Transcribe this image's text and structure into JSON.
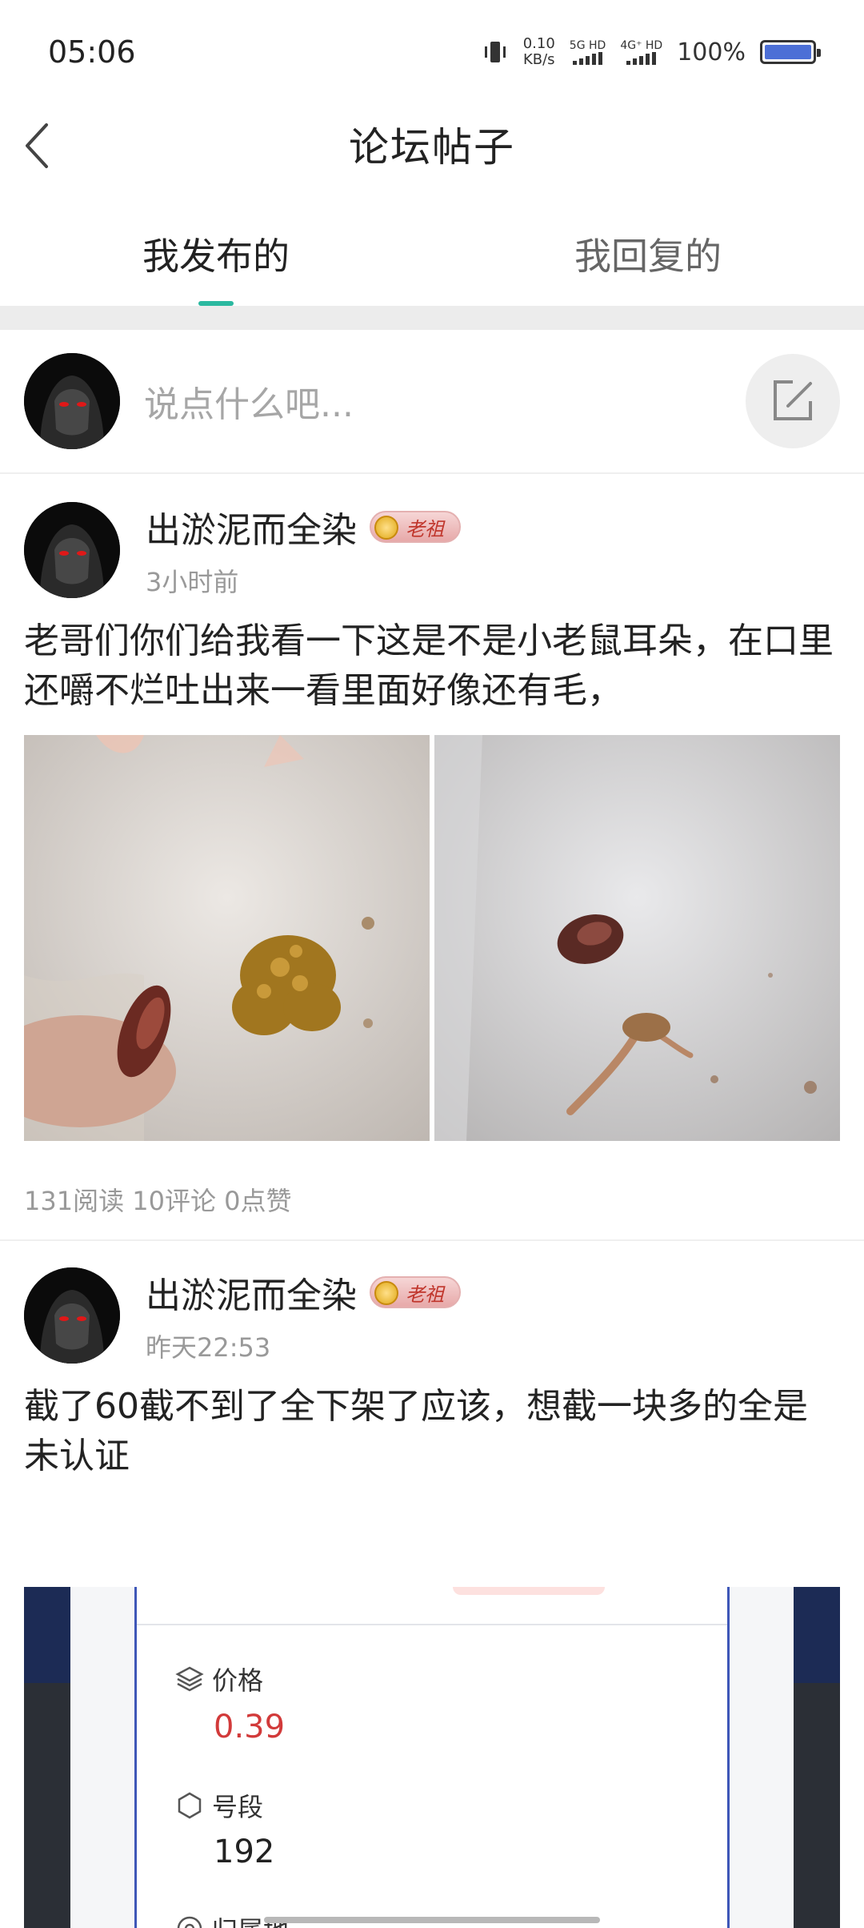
{
  "status_bar": {
    "time": "05:06",
    "net_speed_value": "0.10",
    "net_speed_unit": "KB/s",
    "sim1_label": "5G HD",
    "sim2_label": "4G⁺ HD",
    "battery": "100%",
    "battery_level": 1.0
  },
  "header": {
    "title": "论坛帖子",
    "back_icon": "chevron-left-icon"
  },
  "tabs": [
    {
      "label": "我发布的",
      "active": true
    },
    {
      "label": "我回复的",
      "active": false
    }
  ],
  "compose": {
    "placeholder": "说点什么吧...",
    "button_icon": "edit-icon"
  },
  "posts": [
    {
      "author": "出淤泥而全染",
      "badge": "老祖",
      "time": "3小时前",
      "text": "老哥们你们给我看一下这是不是小老鼠耳朵，在口里还嚼不烂吐出来一看里面好像还有毛，",
      "stats": "131阅读 10评论 0点赞"
    },
    {
      "author": "出淤泥而全染",
      "badge": "老祖",
      "time": "昨天22:53",
      "text": "截了60截不到了全下架了应该，想截一块多的全是未认证",
      "screenshot": {
        "price_label": "价格",
        "price_value": "0.39",
        "segment_label": "号段",
        "segment_value": "192",
        "partial_label": "归属地"
      }
    }
  ],
  "colors": {
    "accent": "#2bb9a0",
    "price": "#d23a3a",
    "muted": "#999999"
  }
}
